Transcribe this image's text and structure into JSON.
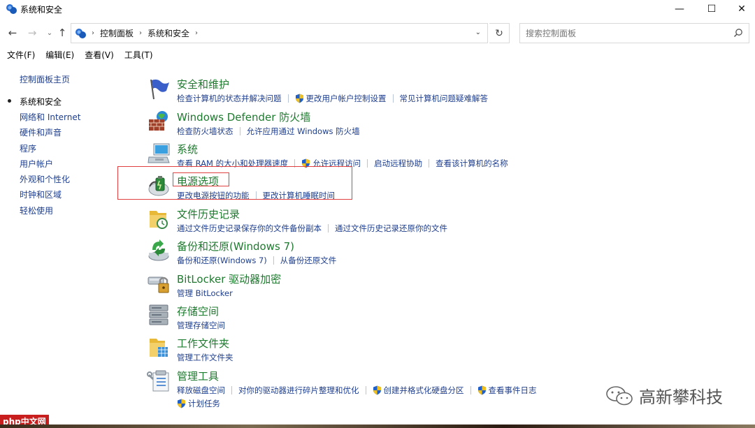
{
  "window": {
    "title": "系统和安全",
    "min_label": "—",
    "max_label": "☐",
    "close_label": "✕"
  },
  "nav": {
    "back": "←",
    "forward": "→",
    "history": "⌄",
    "up": "↑",
    "refresh": "↻",
    "breadcrumbs": [
      "控制面板",
      "系统和安全"
    ],
    "crumb_sep": "›",
    "dropdown": "⌄"
  },
  "search": {
    "placeholder": "搜索控制面板"
  },
  "menu": {
    "items": [
      "文件(F)",
      "编辑(E)",
      "查看(V)",
      "工具(T)"
    ]
  },
  "sidebar": {
    "home": "控制面板主页",
    "items": [
      {
        "label": "系统和安全",
        "active": true
      },
      {
        "label": "网络和 Internet"
      },
      {
        "label": "硬件和声音"
      },
      {
        "label": "程序"
      },
      {
        "label": "用户帐户"
      },
      {
        "label": "外观和个性化"
      },
      {
        "label": "时钟和区域"
      },
      {
        "label": "轻松使用"
      }
    ]
  },
  "categories": [
    {
      "title": "安全和维护",
      "icon": "flag-icon",
      "links": [
        {
          "text": "检查计算机的状态并解决问题"
        },
        {
          "text": "更改用户帐户控制设置",
          "shield": true
        },
        {
          "text": "常见计算机问题疑难解答"
        }
      ]
    },
    {
      "title": "Windows Defender 防火墙",
      "icon": "firewall-icon",
      "links": [
        {
          "text": "检查防火墙状态"
        },
        {
          "text": "允许应用通过 Windows 防火墙"
        }
      ]
    },
    {
      "title": "系统",
      "icon": "system-icon",
      "links": [
        {
          "text": "查看 RAM 的大小和处理器速度"
        },
        {
          "text": "允许远程访问",
          "shield": true
        },
        {
          "text": "启动远程协助"
        },
        {
          "text": "查看该计算机的名称"
        }
      ]
    },
    {
      "title": "电源选项",
      "icon": "power-icon",
      "links": [
        {
          "text": "更改电源按钮的功能"
        },
        {
          "text": "更改计算机睡眠时间"
        }
      ]
    },
    {
      "title": "文件历史记录",
      "icon": "file-history-icon",
      "links": [
        {
          "text": "通过文件历史记录保存你的文件备份副本"
        },
        {
          "text": "通过文件历史记录还原你的文件"
        }
      ]
    },
    {
      "title": "备份和还原(Windows 7)",
      "icon": "backup-icon",
      "links": [
        {
          "text": "备份和还原(Windows 7)"
        },
        {
          "text": "从备份还原文件"
        }
      ]
    },
    {
      "title": "BitLocker 驱动器加密",
      "icon": "bitlocker-icon",
      "links": [
        {
          "text": "管理 BitLocker"
        }
      ]
    },
    {
      "title": "存储空间",
      "icon": "storage-icon",
      "links": [
        {
          "text": "管理存储空间"
        }
      ]
    },
    {
      "title": "工作文件夹",
      "icon": "work-folders-icon",
      "links": [
        {
          "text": "管理工作文件夹"
        }
      ]
    },
    {
      "title": "管理工具",
      "icon": "admin-tools-icon",
      "links": [
        {
          "text": "释放磁盘空间"
        },
        {
          "text": "对你的驱动器进行碎片整理和优化"
        },
        {
          "text": "创建并格式化硬盘分区",
          "shield": true
        },
        {
          "text": "查看事件日志",
          "shield": true
        }
      ],
      "links2": [
        {
          "text": "计划任务",
          "shield": true
        }
      ]
    }
  ],
  "watermarks": {
    "wechat": "高新攀科技",
    "php": "php中文网"
  },
  "colors": {
    "category_title": "#1e7a2e",
    "link": "#1e3e8e",
    "annotation": "#e04040"
  }
}
